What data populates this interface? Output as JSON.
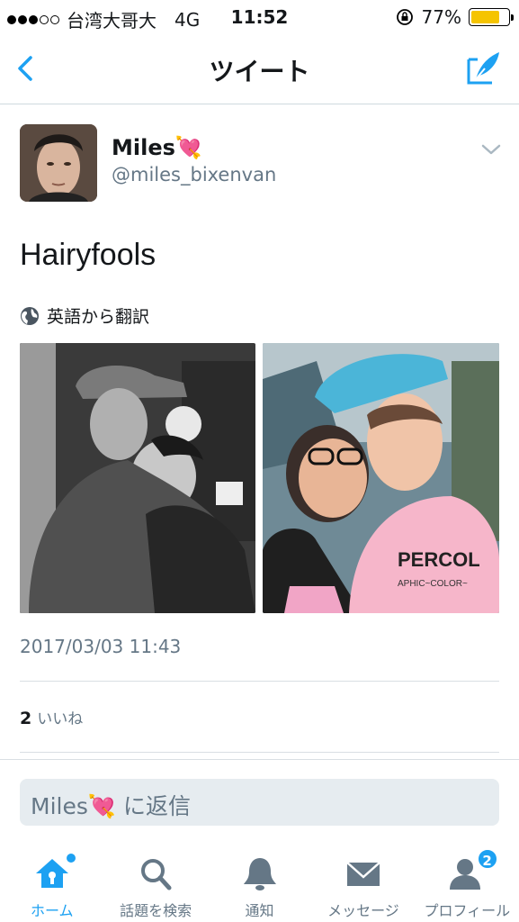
{
  "status_bar": {
    "carrier": "台湾大哥大",
    "network": "4G",
    "time": "11:52",
    "battery": "77%",
    "battery_level": 0.77
  },
  "nav": {
    "title": "ツイート"
  },
  "tweet": {
    "display_name": "Miles",
    "name_emoji": "💘",
    "handle": "@miles_bixenvan",
    "text": "Hairyfools",
    "translate_label": "英語から翻訳",
    "timestamp": "2017/03/03 11:43",
    "likes_count": "2",
    "likes_label": "いいね"
  },
  "reply": {
    "name": "Miles",
    "emoji": "💘",
    "suffix": " に返信"
  },
  "tabs": [
    {
      "label": "ホーム",
      "icon": "home-icon",
      "active": true
    },
    {
      "label": "話題を検索",
      "icon": "search-icon"
    },
    {
      "label": "通知",
      "icon": "bell-icon"
    },
    {
      "label": "メッセージ",
      "icon": "envelope-icon"
    },
    {
      "label": "プロフィール",
      "icon": "profile-icon",
      "badge": "2"
    }
  ],
  "colors": {
    "accent": "#1da1f2",
    "secondary_text": "#657786",
    "battery": "#f5c400"
  }
}
